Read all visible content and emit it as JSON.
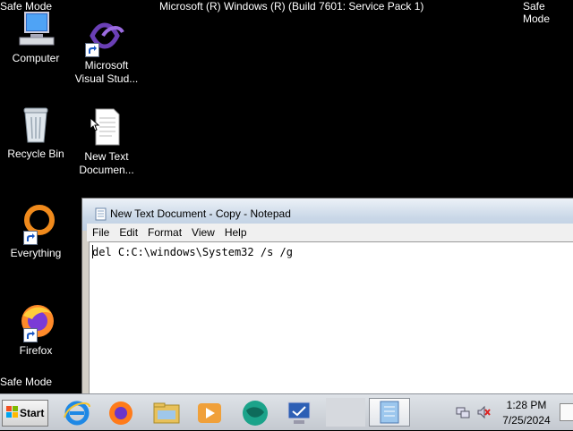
{
  "top_bar": {
    "left_label": "Safe Mode",
    "center_label": "Microsoft (R) Windows (R) (Build 7601: Service Pack 1)",
    "right_label": "Safe Mode"
  },
  "bottom_label": "Safe Mode",
  "desktop_icons": [
    {
      "label": "Computer",
      "icon": "computer-icon"
    },
    {
      "label": "Microsoft Visual Stud...",
      "icon": "visual-studio-icon"
    },
    {
      "label": "Recycle Bin",
      "icon": "recycle-bin-icon"
    },
    {
      "label": "New Text Documen...",
      "icon": "text-file-icon"
    },
    {
      "label": "Everything",
      "icon": "everything-icon"
    },
    {
      "label": "Firefox",
      "icon": "firefox-icon"
    }
  ],
  "notepad": {
    "title": "New Text Document - Copy - Notepad",
    "menu": [
      "File",
      "Edit",
      "Format",
      "View",
      "Help"
    ],
    "content": "del C:C:\\windows\\System32 /s /g"
  },
  "taskbar": {
    "start_label": "Start",
    "apps": [
      "internet-explorer-icon",
      "firefox-icon",
      "file-explorer-icon",
      "media-player-icon",
      "browser-globe-icon",
      "remote-desktop-icon",
      "notepad-icon"
    ]
  },
  "tray": {
    "time": "1:28 PM",
    "date": "7/25/2024"
  }
}
